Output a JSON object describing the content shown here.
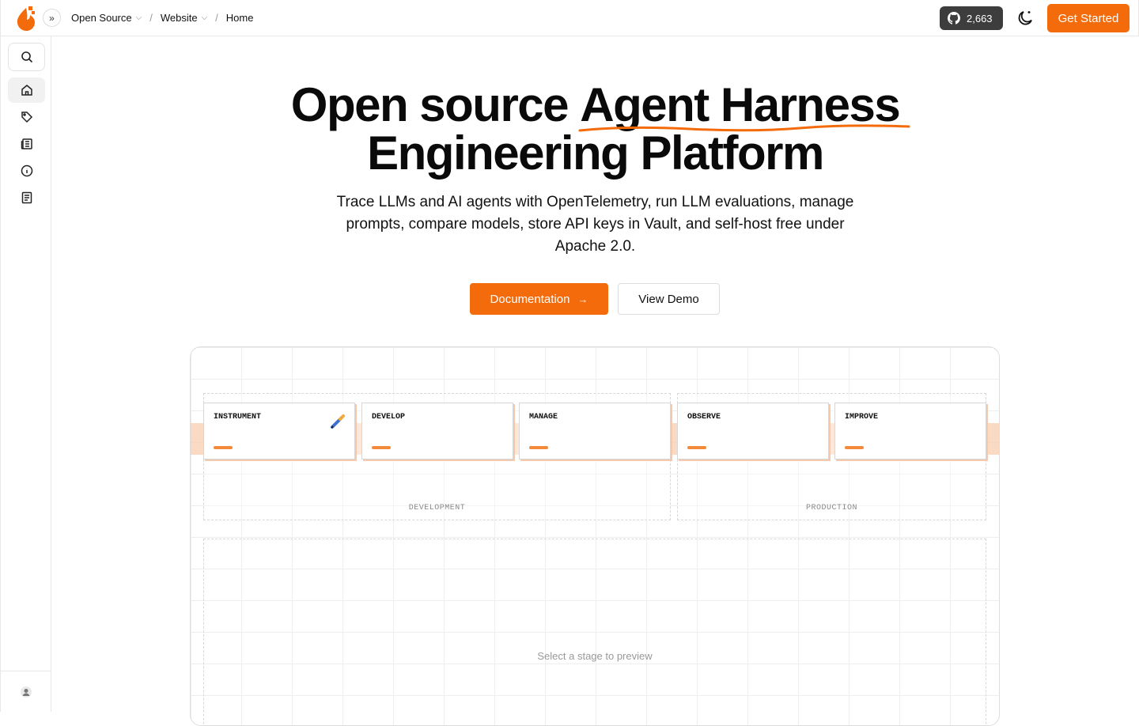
{
  "header": {
    "breadcrumbs": [
      {
        "label": "Open Source",
        "has_dropdown": true
      },
      {
        "label": "Website",
        "has_dropdown": true
      },
      {
        "label": "Home",
        "has_dropdown": false
      }
    ],
    "breadcrumb_separator": "/",
    "github_stars": "2,663",
    "get_started_label": "Get Started"
  },
  "sidebar": {
    "items": [
      {
        "icon": "search-icon"
      },
      {
        "icon": "home-icon",
        "active": true
      },
      {
        "icon": "tag-icon"
      },
      {
        "icon": "newspaper-icon"
      },
      {
        "icon": "info-icon"
      },
      {
        "icon": "book-icon"
      }
    ]
  },
  "hero": {
    "title_line1_plain": "Open source",
    "title_line1_highlight": "Agent Harness",
    "title_line2": "Engineering Platform",
    "subtitle": "Trace LLMs and AI agents with OpenTelemetry, run LLM evaluations, manage prompts, compare models, store API keys in Vault, and self-host free under Apache 2.0.",
    "primary_button": "Documentation",
    "primary_button_arrow": "→",
    "secondary_button": "View Demo"
  },
  "pipeline": {
    "groups": [
      "DEVELOPMENT",
      "PRODUCTION"
    ],
    "stages": [
      "INSTRUMENT",
      "DEVELOP",
      "MANAGE",
      "OBSERVE",
      "IMPROVE"
    ],
    "preview_placeholder": "Select a stage to preview"
  },
  "colors": {
    "accent": "#f46b0b",
    "github_bg": "#3d3d3d",
    "band": "#f9cdb0"
  }
}
